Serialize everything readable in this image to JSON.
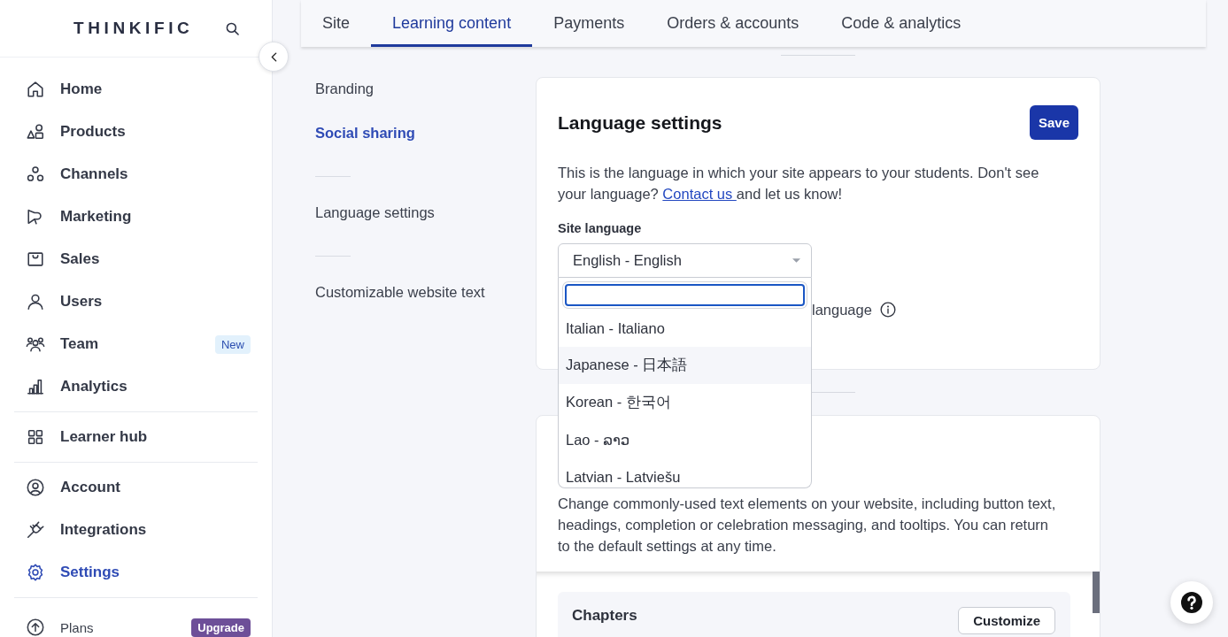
{
  "sidebar": {
    "logo": "THINKIFIC",
    "groups": [
      {
        "items": [
          {
            "label": "Home",
            "selected": false
          },
          {
            "label": "Products",
            "selected": false
          },
          {
            "label": "Channels",
            "selected": false
          },
          {
            "label": "Marketing",
            "selected": false
          },
          {
            "label": "Sales",
            "selected": false
          },
          {
            "label": "Users",
            "selected": false
          },
          {
            "label": "Team",
            "selected": false,
            "badge": "New"
          },
          {
            "label": "Analytics",
            "selected": false
          }
        ]
      },
      {
        "items": [
          {
            "label": "Learner hub",
            "selected": false
          }
        ]
      },
      {
        "items": [
          {
            "label": "Account",
            "selected": false
          },
          {
            "label": "Integrations",
            "selected": false
          },
          {
            "label": "Settings",
            "selected": true
          }
        ]
      }
    ],
    "footer": {
      "label": "Plans",
      "badge": "Upgrade"
    }
  },
  "tabs": [
    {
      "label": "Site",
      "selected": false
    },
    {
      "label": "Learning content",
      "selected": true
    },
    {
      "label": "Payments",
      "selected": false
    },
    {
      "label": "Orders & accounts",
      "selected": false
    },
    {
      "label": "Code & analytics",
      "selected": false
    }
  ],
  "subnav": {
    "groups": [
      {
        "items": [
          {
            "label": "Branding",
            "selected": false
          },
          {
            "label": "Social sharing",
            "selected": true
          }
        ]
      },
      {
        "items": [
          {
            "label": "Language settings",
            "selected": false
          }
        ]
      },
      {
        "items": [
          {
            "label": "Customizable website text",
            "selected": false
          }
        ]
      }
    ]
  },
  "language_card": {
    "title": "Language settings",
    "save_button": "Save",
    "description": "This is the language in which your site appears to your students. Don't see your language? ",
    "link": "Contact us ",
    "description_end": "and let us know!",
    "site_language": {
      "label": "Site language",
      "value": "English - English",
      "expanded": true,
      "options": [
        {
          "label": "Italian - Italiano",
          "highlighted": false
        },
        {
          "label": "Japanese - 日本語",
          "highlighted": true
        },
        {
          "label": "Korean - 한국어",
          "highlighted": false
        },
        {
          "label": "Lao - ລາວ",
          "highlighted": false
        },
        {
          "label": "Latvian - Latviešu",
          "highlighted": false
        }
      ]
    },
    "option_row": {
      "label": "language"
    }
  },
  "text_card": {
    "description": "Change commonly-used text elements on your website, including button text, headings, completion or celebration messaging, and tooltips. You can return to the default settings at any time.",
    "sections": [
      {
        "title": "Chapters",
        "button": "Customize"
      }
    ]
  }
}
